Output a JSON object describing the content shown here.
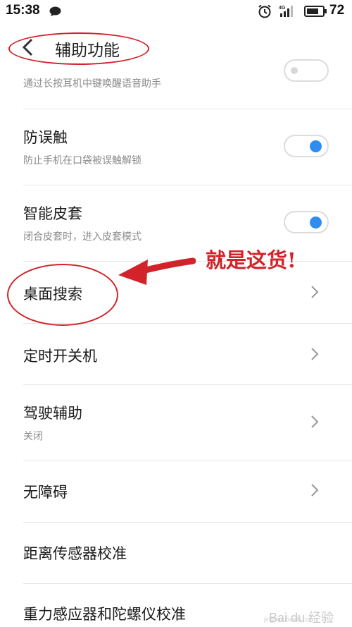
{
  "status_bar": {
    "time": "15:38",
    "network": "4G",
    "battery": "72"
  },
  "header": {
    "title": "辅助功能"
  },
  "items": [
    {
      "label": "",
      "sub": "通过长按耳机中键唤醒语音助手",
      "control": "toggle",
      "state": "off"
    },
    {
      "label": "防误触",
      "sub": "防止手机在口袋被误触解锁",
      "control": "toggle",
      "state": "on"
    },
    {
      "label": "智能皮套",
      "sub": "闭合皮套时，进入皮套模式",
      "control": "toggle",
      "state": "on"
    },
    {
      "label": "桌面搜索",
      "sub": "",
      "control": "chevron"
    },
    {
      "label": "定时开关机",
      "sub": "",
      "control": "chevron"
    },
    {
      "label": "驾驶辅助",
      "sub": "关闭",
      "control": "chevron"
    },
    {
      "label": "无障碍",
      "sub": "",
      "control": "chevron"
    },
    {
      "label": "距离传感器校准",
      "sub": "",
      "control": "none"
    },
    {
      "label": "重力感应器和陀螺仪校准",
      "sub": "",
      "control": "none"
    }
  ],
  "annotation": {
    "text": "就是这货!",
    "color": "#d3232a"
  },
  "watermark": {
    "text": "Bai du 经验",
    "url": "jingyan.baidu.com"
  },
  "colors": {
    "accent": "#2f8df0",
    "annotation": "#d3232a"
  }
}
